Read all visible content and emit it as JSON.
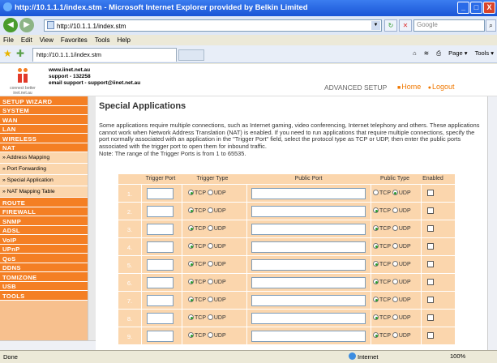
{
  "window": {
    "title": "http://10.1.1.1/index.stm - Microsoft Internet Explorer provided by Belkin Limited",
    "controls": [
      "_",
      "□",
      "X"
    ]
  },
  "navbar": {
    "back": "◀",
    "forward": "▶",
    "url": "http://10.1.1.1/index.stm",
    "refresh": "↻",
    "stop": "✕",
    "search_placeholder": "Google"
  },
  "menu": [
    "File",
    "Edit",
    "View",
    "Favorites",
    "Tools",
    "Help"
  ],
  "favbar": {
    "tab_title": "http://10.1.1.1/index.stm",
    "tools": [
      "Page ▾",
      "Tools ▾"
    ]
  },
  "header": {
    "logo_text": "connect better",
    "logo_site": "inet.net.au",
    "site": "www.iinet.net.au",
    "support_phone": "support - 132258",
    "support_email": "email support - support@iinet.net.au",
    "advanced_setup": "ADVANCED SETUP",
    "home_link": "Home",
    "logout_link": "Logout"
  },
  "sidebar": {
    "items": [
      {
        "label": "SETUP WIZARD",
        "type": "section"
      },
      {
        "label": "SYSTEM",
        "type": "section"
      },
      {
        "label": "WAN",
        "type": "section"
      },
      {
        "label": "LAN",
        "type": "section"
      },
      {
        "label": "WIRELESS",
        "type": "section"
      },
      {
        "label": "NAT",
        "type": "section"
      },
      {
        "label": "» Address Mapping",
        "type": "sub"
      },
      {
        "label": "» Port Forwarding",
        "type": "sub"
      },
      {
        "label": "» Special Application",
        "type": "sub"
      },
      {
        "label": "» NAT Mapping Table",
        "type": "sub"
      },
      {
        "label": "ROUTE",
        "type": "section"
      },
      {
        "label": "FIREWALL",
        "type": "section"
      },
      {
        "label": "SNMP",
        "type": "section"
      },
      {
        "label": "ADSL",
        "type": "section"
      },
      {
        "label": "VoIP",
        "type": "section"
      },
      {
        "label": "UPnP",
        "type": "section"
      },
      {
        "label": "QoS",
        "type": "section"
      },
      {
        "label": "DDNS",
        "type": "section"
      },
      {
        "label": "TOMIZONE",
        "type": "section"
      },
      {
        "label": "USB",
        "type": "section"
      },
      {
        "label": "TOOLS",
        "type": "section"
      }
    ]
  },
  "main": {
    "title": "Special Applications",
    "description": "Some applications require multiple connections, such as Internet gaming, video conferencing, Internet telephony and others. These applications cannot work when Network Address Translation (NAT) is enabled. If you need to run applications that require multiple connections, specify the port normally associated with an application in the \"Trigger Port\" field, select the protocol type as TCP or UDP, then enter the public ports associated with the trigger port to open them for inbound traffic.",
    "note": "Note: The range of the Trigger Ports is from 1 to 65535.",
    "columns": [
      "Trigger Port",
      "Trigger Type",
      "Public Port",
      "Public Type",
      "Enabled"
    ],
    "tcp_label": "TCP",
    "udp_label": "UDP",
    "rows": [
      {
        "num": "1.",
        "trigger_type": "TCP",
        "public_type": "UDP",
        "enabled": false
      },
      {
        "num": "2.",
        "trigger_type": "TCP",
        "public_type": "TCP",
        "enabled": false
      },
      {
        "num": "3.",
        "trigger_type": "TCP",
        "public_type": "TCP",
        "enabled": false
      },
      {
        "num": "4.",
        "trigger_type": "TCP",
        "public_type": "TCP",
        "enabled": false
      },
      {
        "num": "5.",
        "trigger_type": "TCP",
        "public_type": "TCP",
        "enabled": false
      },
      {
        "num": "6.",
        "trigger_type": "TCP",
        "public_type": "TCP",
        "enabled": false
      },
      {
        "num": "7.",
        "trigger_type": "TCP",
        "public_type": "TCP",
        "enabled": false
      },
      {
        "num": "8.",
        "trigger_type": "TCP",
        "public_type": "TCP",
        "enabled": false
      },
      {
        "num": "9.",
        "trigger_type": "TCP",
        "public_type": "TCP",
        "enabled": false
      }
    ]
  },
  "status": {
    "text": "Done",
    "zone": "Internet",
    "zoom": "100%"
  },
  "colors": {
    "accent_orange": "#f47f24",
    "panel_peach": "#fbd6ad",
    "radio_green": "#2a9a2a"
  }
}
